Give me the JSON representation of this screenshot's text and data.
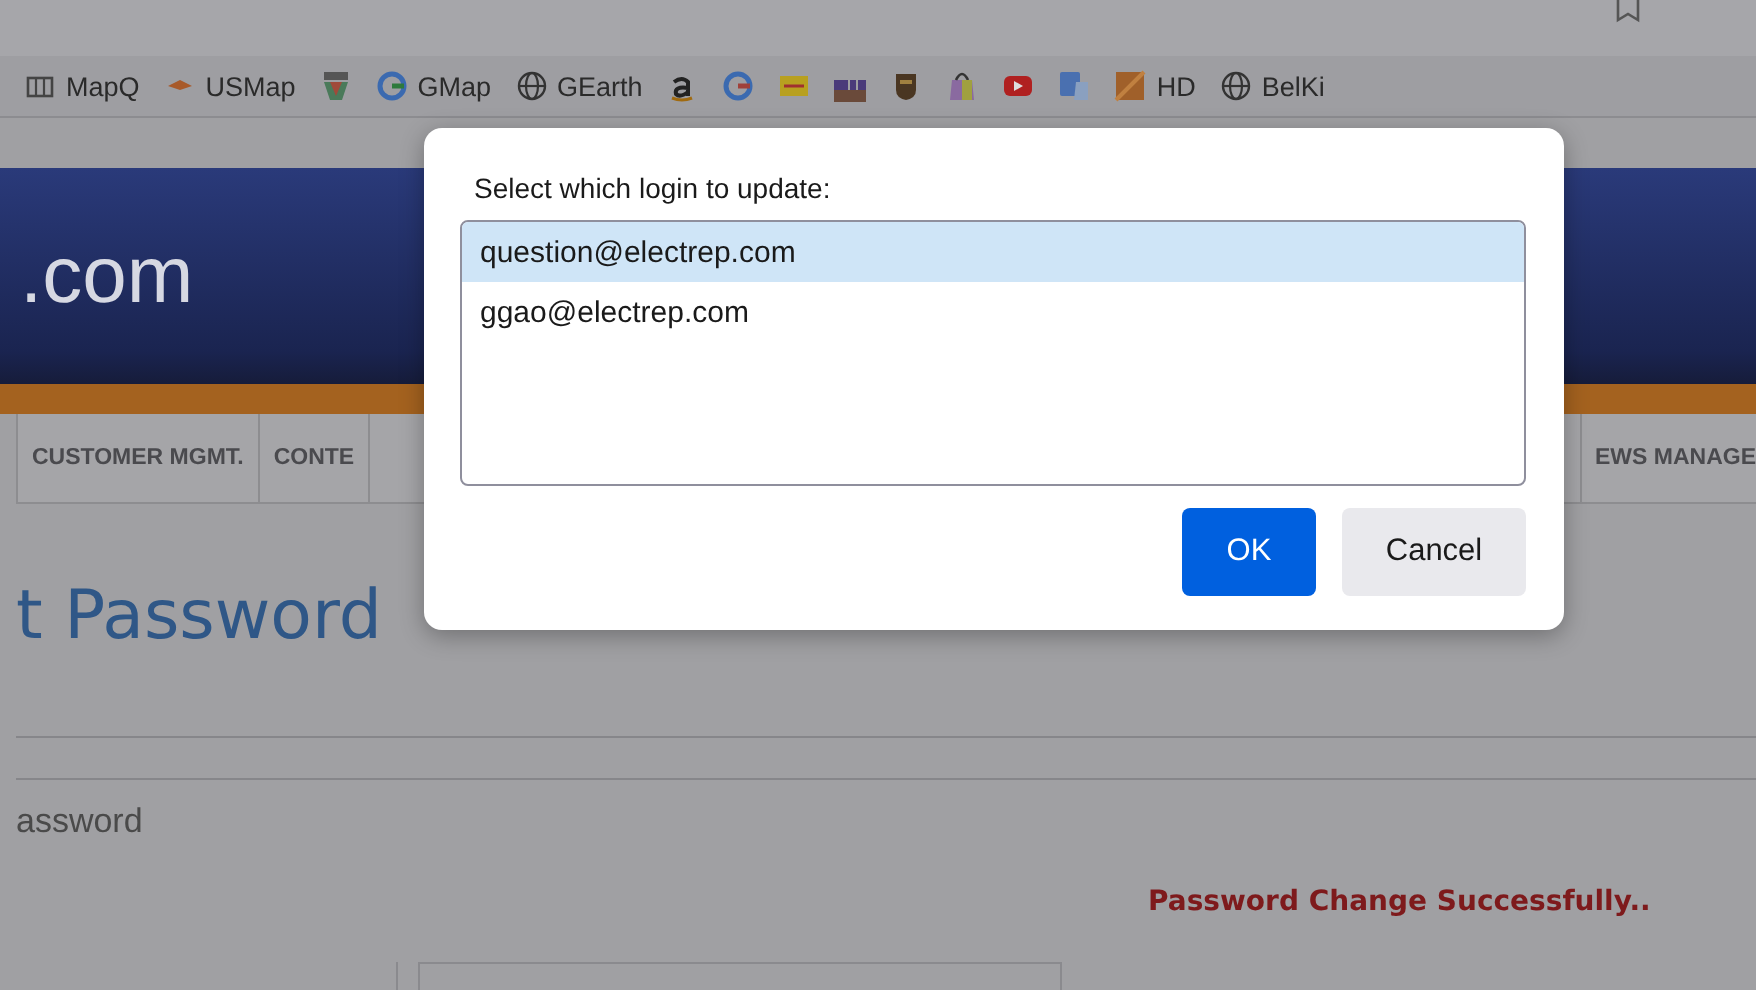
{
  "bookmarks": [
    {
      "kind": "labeled",
      "label": "MapQ"
    },
    {
      "kind": "labeled",
      "label": "USMap"
    },
    {
      "kind": "icon"
    },
    {
      "kind": "labeled",
      "label": "GMap"
    },
    {
      "kind": "labeled",
      "label": "GEarth"
    },
    {
      "kind": "icon"
    },
    {
      "kind": "icon"
    },
    {
      "kind": "icon"
    },
    {
      "kind": "icon"
    },
    {
      "kind": "icon"
    },
    {
      "kind": "icon"
    },
    {
      "kind": "icon"
    },
    {
      "kind": "icon"
    },
    {
      "kind": "labeled",
      "label": "HD"
    },
    {
      "kind": "labeled",
      "label": "BelKi"
    }
  ],
  "site": {
    "logo_text": ".com",
    "nav": [
      {
        "label": "CUSTOMER MGMT."
      },
      {
        "label": "CONTE"
      },
      {
        "label": "EWS MANAGE"
      }
    ],
    "page_title": "t Password",
    "section_label": "assword",
    "message": "Password Change Successfully.."
  },
  "dialog": {
    "prompt": "Select which login to update:",
    "logins": [
      {
        "label": "question@electrep.com",
        "selected": true
      },
      {
        "label": "ggao@electrep.com",
        "selected": false
      }
    ],
    "buttons": [
      {
        "label": "OK",
        "kind": "primary"
      },
      {
        "label": "Cancel",
        "kind": "secondary"
      }
    ]
  }
}
